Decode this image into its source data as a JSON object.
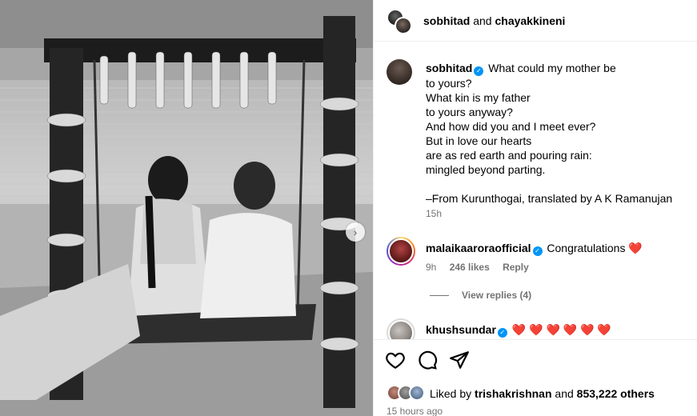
{
  "header": {
    "user_a": "sobhitad",
    "conjunction": "and",
    "user_b": "chayakkineni"
  },
  "caption": {
    "username": "sobhitad",
    "lines": [
      "What could my mother be",
      "to yours?",
      "What kin is my father",
      "to yours anyway?",
      "And how did you and I meet ever?",
      "But in love our hearts",
      "are as red earth and pouring rain:",
      "mingled beyond parting."
    ],
    "credit": "–From Kurunthogai, translated by A K Ramanujan",
    "time": "15h"
  },
  "comments": [
    {
      "username": "malaikaarora official",
      "display_username": "malaikaaroraofficial",
      "text": "Congratulations",
      "emoji": "❤️",
      "time": "9h",
      "likes": "246 likes",
      "reply_label": "Reply",
      "view_replies": "View replies (4)"
    },
    {
      "username": "khushsundar",
      "hearts": "❤️ ❤️ ❤️ ❤️ ❤️ ❤️"
    }
  ],
  "actions": {
    "like_icon": "heart-outline-icon",
    "comment_icon": "comment-bubble-icon",
    "share_icon": "paper-plane-icon"
  },
  "likes": {
    "prefix": "Liked by",
    "user": "trishakrishnan",
    "middle": "and",
    "count": "853,222 others"
  },
  "posted_time": "15 hours ago",
  "next_button": "›"
}
